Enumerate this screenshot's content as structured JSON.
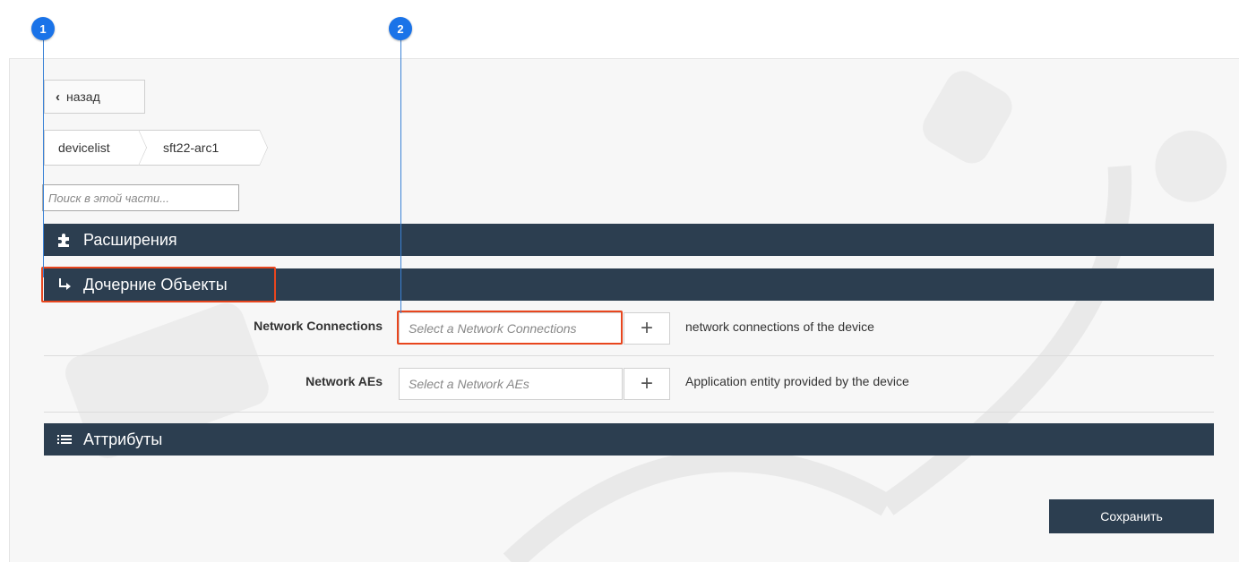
{
  "callouts": {
    "badge_1": "1",
    "badge_2": "2"
  },
  "nav": {
    "back_label": "назад"
  },
  "breadcrumb": {
    "items": [
      "devicelist",
      "sft22-arc1"
    ]
  },
  "search": {
    "placeholder": "Поиск в этой части..."
  },
  "sections": {
    "extensions": {
      "label": "Расширения",
      "icon": "puzzle-icon"
    },
    "children": {
      "label": "Дочерние Объекты",
      "icon": "child-arrow-icon"
    },
    "attributes": {
      "label": "Аттрибуты",
      "icon": "list-icon"
    }
  },
  "fields": [
    {
      "label": "Network Connections",
      "placeholder": "Select a Network Connections",
      "add": "+",
      "description": "network connections of the device"
    },
    {
      "label": "Network AEs",
      "placeholder": "Select a Network AEs",
      "add": "+",
      "description": "Application entity provided by the device"
    }
  ],
  "actions": {
    "save_label": "Сохранить"
  },
  "colors": {
    "section_bar": "#2c3e50",
    "highlight": "#e8461e",
    "callout": "#1a73e8"
  }
}
